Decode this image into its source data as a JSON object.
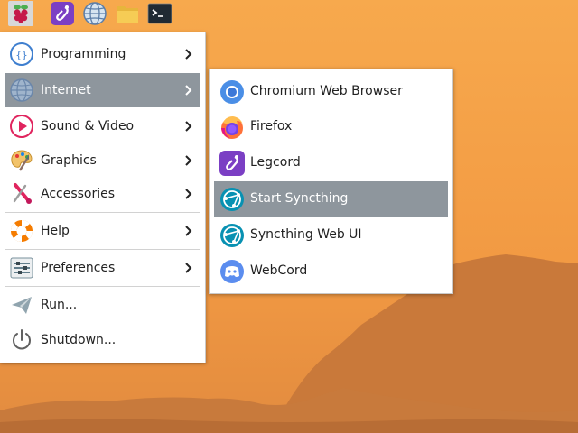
{
  "colors": {
    "selection": "#8e969d",
    "wallpaper_top": "#f5a44a",
    "wallpaper_bottom": "#d9873c",
    "mountain": "#c97a3a"
  },
  "taskbar": {
    "items": [
      {
        "name": "raspberry-menu-icon"
      },
      {
        "name": "legcord-launcher-icon"
      },
      {
        "name": "web-browser-icon"
      },
      {
        "name": "file-manager-icon"
      },
      {
        "name": "terminal-icon"
      }
    ]
  },
  "main_menu": {
    "items": [
      {
        "label": "Programming",
        "icon": "programming-icon",
        "submenu": true
      },
      {
        "label": "Internet",
        "icon": "globe-icon",
        "submenu": true,
        "selected": true
      },
      {
        "label": "Sound & Video",
        "icon": "play-icon",
        "submenu": true
      },
      {
        "label": "Graphics",
        "icon": "palette-icon",
        "submenu": true
      },
      {
        "label": "Accessories",
        "icon": "tools-icon",
        "submenu": true
      },
      {
        "label": "Help",
        "icon": "lifebuoy-icon",
        "submenu": true
      },
      {
        "label": "Preferences",
        "icon": "sliders-icon",
        "submenu": true
      },
      {
        "label": "Run...",
        "icon": "paper-plane-icon",
        "submenu": false
      },
      {
        "label": "Shutdown...",
        "icon": "power-icon",
        "submenu": false
      }
    ]
  },
  "internet_submenu": {
    "items": [
      {
        "label": "Chromium Web Browser",
        "icon": "chromium-icon"
      },
      {
        "label": "Firefox",
        "icon": "firefox-icon"
      },
      {
        "label": "Legcord",
        "icon": "legcord-icon"
      },
      {
        "label": "Start Syncthing",
        "icon": "syncthing-icon",
        "selected": true
      },
      {
        "label": "Syncthing Web UI",
        "icon": "syncthing-icon"
      },
      {
        "label": "WebCord",
        "icon": "webcord-icon"
      }
    ]
  }
}
